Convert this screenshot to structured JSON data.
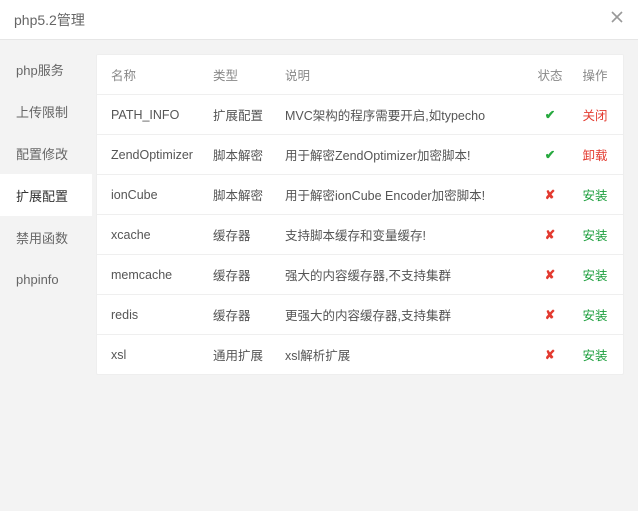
{
  "header": {
    "title": "php5.2管理"
  },
  "sidebar": {
    "items": [
      {
        "label": "php服务"
      },
      {
        "label": "上传限制"
      },
      {
        "label": "配置修改"
      },
      {
        "label": "扩展配置",
        "active": true
      },
      {
        "label": "禁用函数"
      },
      {
        "label": "phpinfo"
      }
    ]
  },
  "table": {
    "columns": {
      "name": "名称",
      "type": "类型",
      "desc": "说明",
      "status": "状态",
      "action": "操作"
    },
    "status_glyphs": {
      "ok": "✔",
      "no": "✘"
    },
    "actions": {
      "close": "关闭",
      "uninstall": "卸载",
      "install": "安装"
    },
    "rows": [
      {
        "name": "PATH_INFO",
        "type": "扩展配置",
        "desc": "MVC架构的程序需要开启,如typecho",
        "status": "ok",
        "action": "close"
      },
      {
        "name": "ZendOptimizer",
        "type": "脚本解密",
        "desc": "用于解密ZendOptimizer加密脚本!",
        "status": "ok",
        "action": "uninstall"
      },
      {
        "name": "ionCube",
        "type": "脚本解密",
        "desc": "用于解密ionCube Encoder加密脚本!",
        "status": "no",
        "action": "install"
      },
      {
        "name": "xcache",
        "type": "缓存器",
        "desc": "支持脚本缓存和变量缓存!",
        "status": "no",
        "action": "install"
      },
      {
        "name": "memcache",
        "type": "缓存器",
        "desc": "强大的内容缓存器,不支持集群",
        "status": "no",
        "action": "install"
      },
      {
        "name": "redis",
        "type": "缓存器",
        "desc": "更强大的内容缓存器,支持集群",
        "status": "no",
        "action": "install"
      },
      {
        "name": "xsl",
        "type": "通用扩展",
        "desc": "xsl解析扩展",
        "status": "no",
        "action": "install"
      }
    ]
  }
}
